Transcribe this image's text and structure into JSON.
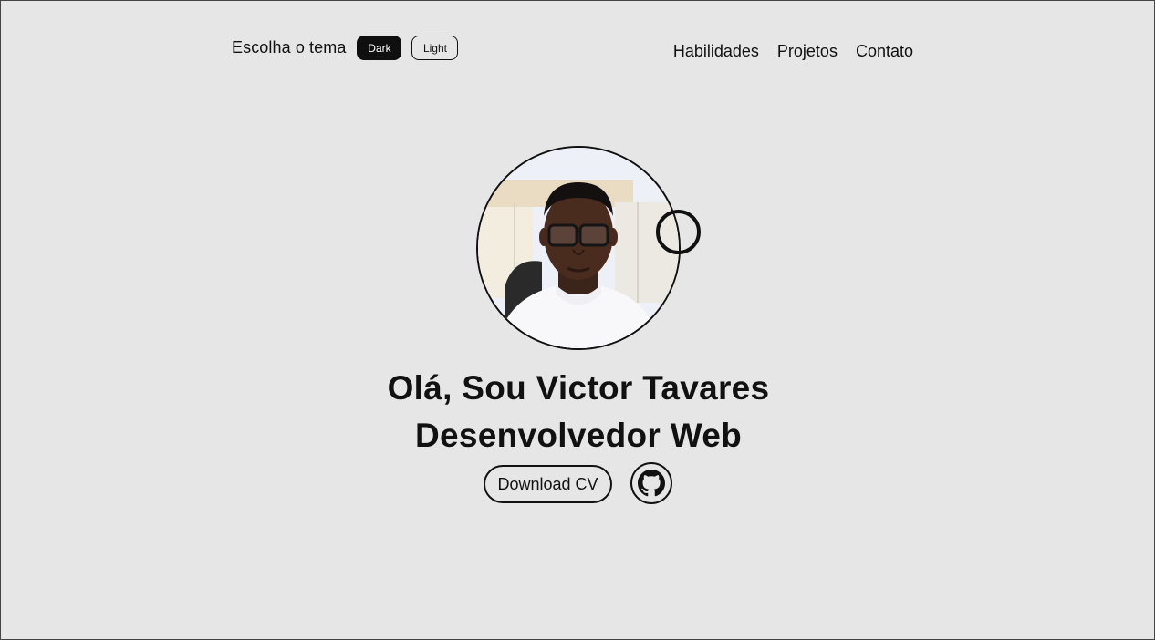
{
  "theme": {
    "label": "Escolha o tema",
    "dark_label": "Dark",
    "light_label": "Light"
  },
  "nav": {
    "items": [
      {
        "label": "Habilidades"
      },
      {
        "label": "Projetos"
      },
      {
        "label": "Contato"
      }
    ]
  },
  "hero": {
    "greeting": "Olá, Sou Victor Tavares",
    "role": "Desenvolvedor Web",
    "cv_label": "Download CV",
    "github_icon": "github-icon",
    "avatar": "profile-photo"
  },
  "colors": {
    "background": "#e6e6e6",
    "text": "#111111",
    "dark_button": "#0f0f0f"
  }
}
